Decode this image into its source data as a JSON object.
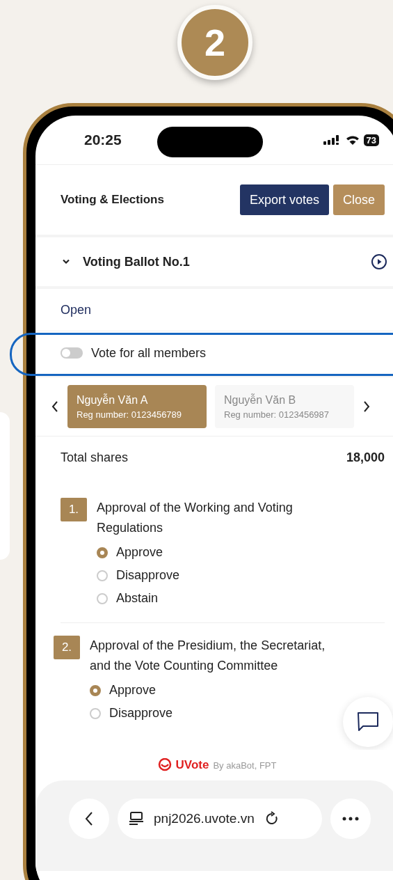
{
  "step_badge": "2",
  "status_bar": {
    "time": "20:25",
    "battery": "73"
  },
  "header": {
    "title": "Voting & Elections",
    "buttons": [
      {
        "label": "Export votes",
        "kind": "primary"
      },
      {
        "label": "Close",
        "kind": "secondary"
      }
    ]
  },
  "ballot": {
    "title": "Voting Ballot No.1",
    "expanded": true
  },
  "ballot_status": "Open",
  "vote_all_toggle": {
    "label": "Vote for all members",
    "on": false,
    "highlighted": true
  },
  "members": [
    {
      "name": "Nguyễn Văn A",
      "reg": "Reg number: 0123456789",
      "selected": true
    },
    {
      "name": "Nguyễn Văn B",
      "reg": "Reg number: 0123456987",
      "selected": false
    }
  ],
  "total_shares": {
    "label": "Total shares",
    "value": "18,000"
  },
  "questions": [
    {
      "number": "1.",
      "title": "Approval of the Working and Voting Regulations",
      "options": [
        {
          "label": "Approve",
          "selected": true
        },
        {
          "label": "Disapprove",
          "selected": false
        },
        {
          "label": "Abstain",
          "selected": false
        }
      ]
    },
    {
      "number": "2.",
      "title": "Approval of the Presidium, the Secretariat, and the Vote Counting Committee",
      "options": [
        {
          "label": "Approve",
          "selected": true
        },
        {
          "label": "Disapprove",
          "selected": false
        }
      ]
    }
  ],
  "footer": {
    "brand": "UVote",
    "credit": "By akaBot, FPT"
  },
  "browser": {
    "url": "pnj2026.uvote.vn"
  }
}
